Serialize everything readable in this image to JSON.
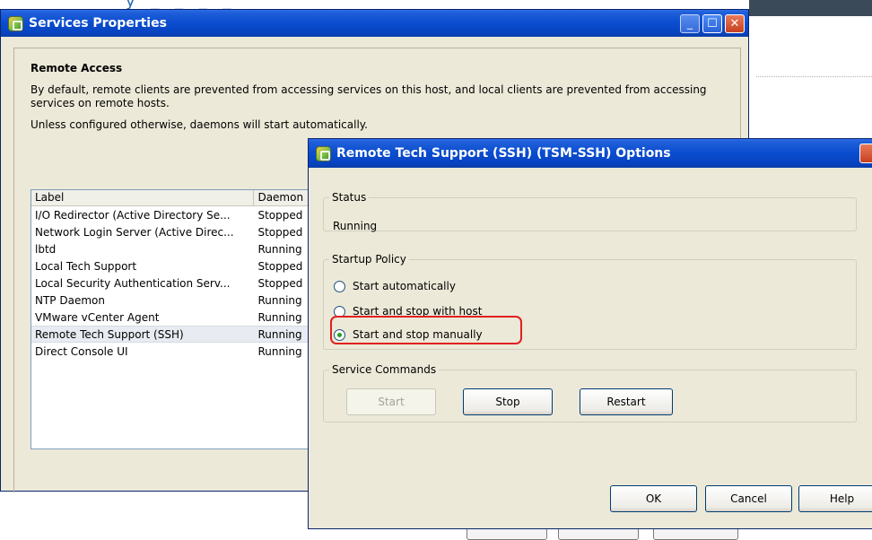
{
  "background": {
    "heading_fragment": "y _ _ _ _"
  },
  "main_window": {
    "title": "Services Properties",
    "section_title": "Remote Access",
    "description": "By default, remote clients are prevented from accessing services on this host, and local clients are prevented from accessing services on remote hosts.",
    "daemons_note": "Unless configured otherwise, daemons will start automatically.",
    "table": {
      "columns": [
        "Label",
        "Daemon"
      ],
      "rows": [
        {
          "label": "I/O Redirector (Active Directory Se...",
          "daemon": "Stopped"
        },
        {
          "label": "Network Login Server (Active Direc...",
          "daemon": "Stopped"
        },
        {
          "label": "lbtd",
          "daemon": "Running"
        },
        {
          "label": "Local Tech Support",
          "daemon": "Stopped"
        },
        {
          "label": "Local Security Authentication Serv...",
          "daemon": "Stopped"
        },
        {
          "label": "NTP Daemon",
          "daemon": "Running"
        },
        {
          "label": "VMware vCenter Agent",
          "daemon": "Running"
        },
        {
          "label": "Remote Tech Support (SSH)",
          "daemon": "Running"
        },
        {
          "label": "Direct Console UI",
          "daemon": "Running"
        }
      ],
      "selected_row": "Remote Tech Support (SSH)"
    }
  },
  "dialog": {
    "title": "Remote Tech Support (SSH) (TSM-SSH) Options",
    "status": {
      "legend": "Status",
      "value": "Running"
    },
    "startup_policy": {
      "legend": "Startup Policy",
      "options": [
        {
          "label": "Start automatically",
          "checked": false
        },
        {
          "label": "Start and stop with host",
          "checked": false
        },
        {
          "label": "Start and stop manually",
          "checked": true
        }
      ]
    },
    "service_commands": {
      "legend": "Service Commands",
      "start": "Start",
      "stop": "Stop",
      "restart": "Restart"
    },
    "buttons": {
      "ok": "OK",
      "cancel": "Cancel",
      "help": "Help"
    }
  },
  "colors": {
    "title_bar": "#0a4ccf",
    "dialog_bg": "#ece9d8",
    "highlight": "#e02020",
    "selected_row": "#e8ebf1"
  }
}
